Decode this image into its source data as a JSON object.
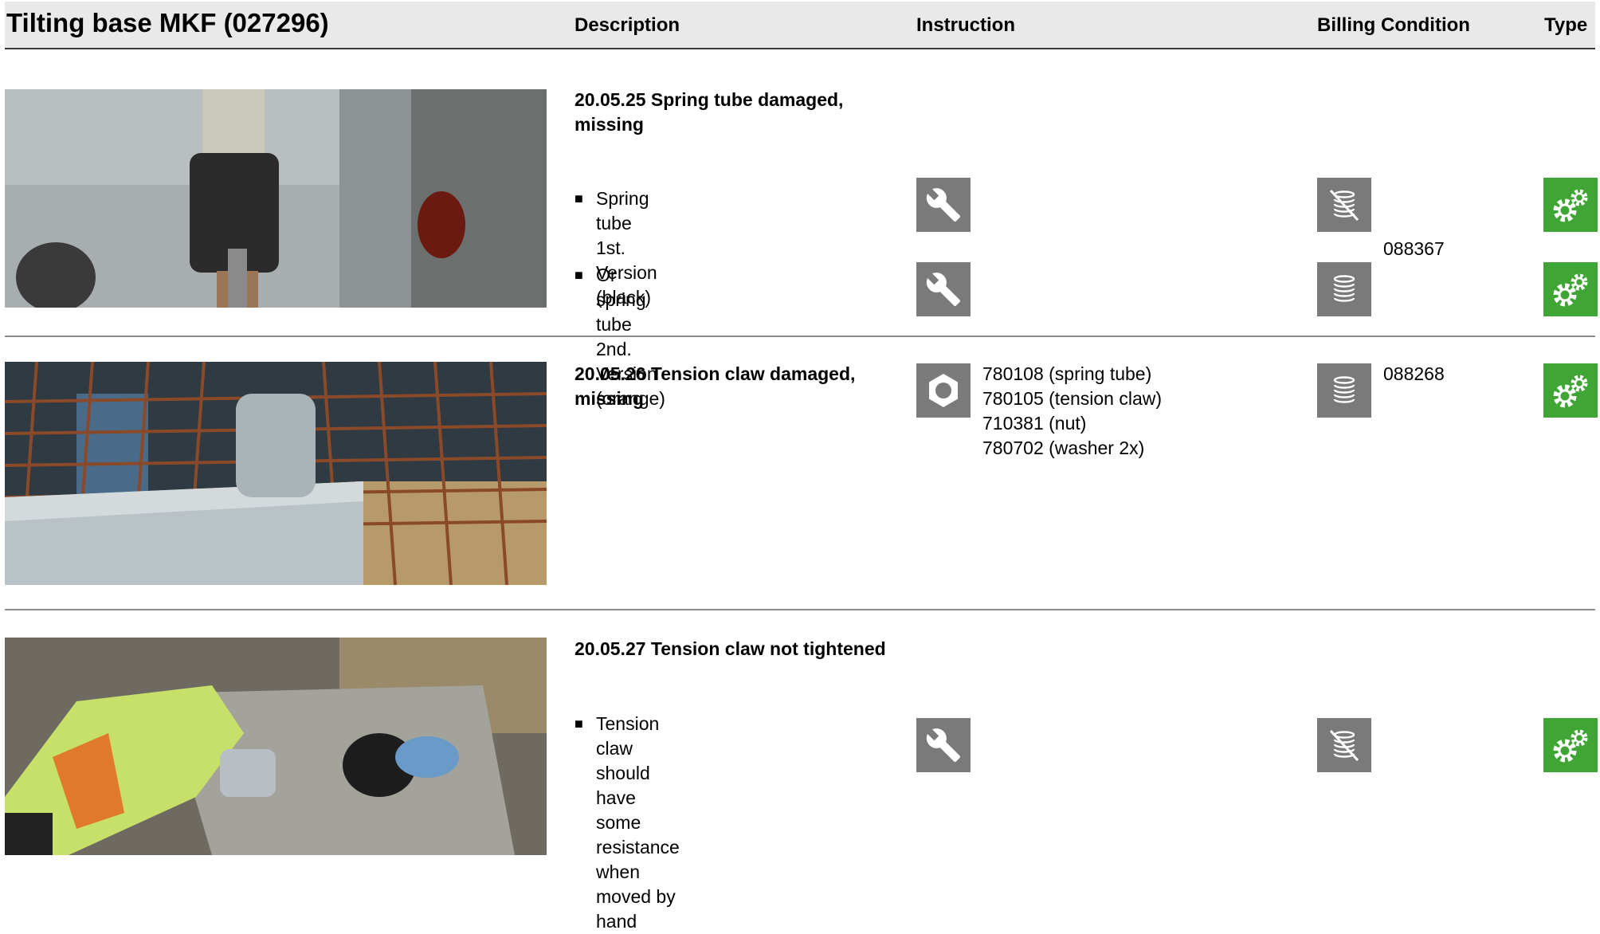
{
  "header": {
    "title": "Tilting base MKF (027296)",
    "columns": {
      "description": "Description",
      "instruction": "Instruction",
      "billing": "Billing Condition",
      "type": "Type"
    }
  },
  "rows": [
    {
      "heading_line1": "20.05.25 Spring tube damaged,",
      "heading_line2": "missing",
      "items": [
        {
          "text": "Spring tube 1st. Version (black)",
          "instruction_icon": "wrench-icon",
          "billing_icon": "no-billing-coins-icon",
          "type_icon": "gears-icon"
        },
        {
          "text_line1": "Or spring tube 2nd. Version",
          "text_line2": "(orange)",
          "instruction_icon": "wrench-icon",
          "billing_icon": "billing-coins-icon",
          "type_icon": "gears-icon"
        }
      ],
      "billing_code": "088367"
    },
    {
      "heading_line1": "20.05.26 Tension claw damaged,",
      "heading_line2": "missing",
      "instruction_icon": "nut-icon",
      "parts": [
        "780108 (spring tube)",
        "780105 (tension claw)",
        "710381 (nut)",
        "780702 (washer 2x)"
      ],
      "billing_icon": "billing-coins-icon",
      "billing_code": "088268",
      "type_icon": "gears-icon"
    },
    {
      "heading": "20.05.27 Tension claw not tightened",
      "items": [
        {
          "text_line1": "Tension claw should have some",
          "text_line2": "resistance when moved by hand",
          "instruction_icon": "wrench-icon",
          "billing_icon": "no-billing-coins-icon",
          "type_icon": "gears-icon"
        }
      ]
    }
  ],
  "bullet": "■",
  "colors": {
    "header_bg": "#e9e9e9",
    "icon_gray": "#7a7a7a",
    "type_green": "#3fa535"
  }
}
